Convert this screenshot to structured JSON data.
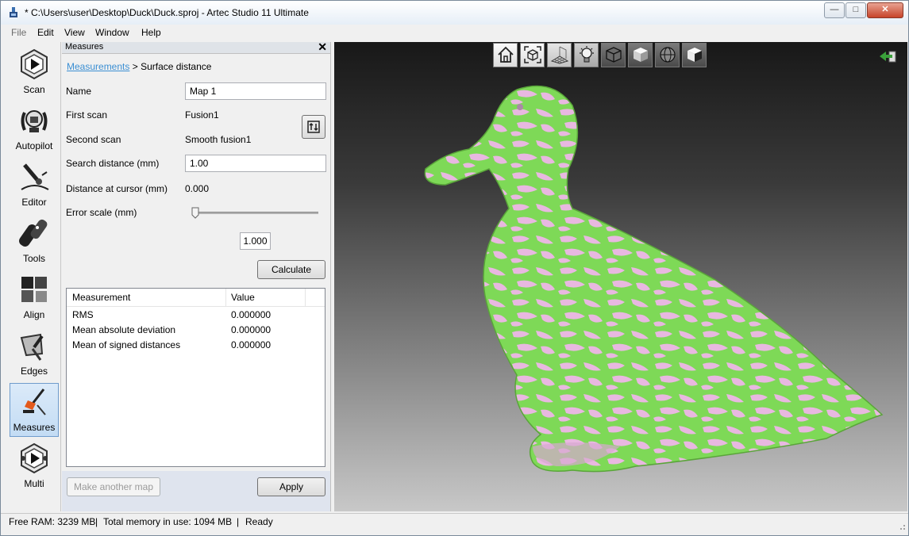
{
  "window": {
    "title": "* C:\\Users\\user\\Desktop\\Duck\\Duck.sproj - Artec Studio 11 Ultimate",
    "controls": {
      "minimize": "—",
      "maximize": "□",
      "close": "✕"
    }
  },
  "menu": [
    "File",
    "Edit",
    "View",
    "Window",
    "Help"
  ],
  "sidebar": {
    "items": [
      {
        "label": "Scan",
        "icon": "scan-icon"
      },
      {
        "label": "Autopilot",
        "icon": "autopilot-icon"
      },
      {
        "label": "Editor",
        "icon": "editor-icon"
      },
      {
        "label": "Tools",
        "icon": "tools-icon"
      },
      {
        "label": "Align",
        "icon": "align-icon"
      },
      {
        "label": "Edges",
        "icon": "edges-icon"
      },
      {
        "label": "Measures",
        "icon": "measures-icon",
        "active": true
      },
      {
        "label": "Multi",
        "icon": "multi-icon"
      }
    ]
  },
  "panel": {
    "title": "Measures",
    "close": "✕",
    "breadcrumb": {
      "link": "Measurements",
      "separator": " > ",
      "current": "Surface distance"
    },
    "fields": {
      "name_label": "Name",
      "name_value": "Map 1",
      "first_scan_label": "First scan",
      "first_scan_value": "Fusion1",
      "second_scan_label": "Second scan",
      "second_scan_value": "Smooth fusion1",
      "search_distance_label": "Search distance (mm)",
      "search_distance_value": "1.00",
      "distance_cursor_label": "Distance at cursor (mm)",
      "distance_cursor_value": "0.000",
      "error_scale_label": "Error scale (mm)",
      "error_scale_value": "1.000",
      "error_scale_slider_level": 0.02
    },
    "calculate_label": "Calculate",
    "table": {
      "headers": [
        "Measurement",
        "Value"
      ],
      "rows": [
        [
          "RMS",
          "0.000000"
        ],
        [
          "Mean absolute deviation",
          "0.000000"
        ],
        [
          "Mean of signed distances",
          "0.000000"
        ]
      ]
    },
    "make_another_label": "Make another map",
    "apply_label": "Apply"
  },
  "viewport": {
    "toolbar_icons": [
      "home-view-icon",
      "fit-view-icon",
      "grid-icon",
      "light-icon",
      "wireframe-cube-icon",
      "solid-cube-icon",
      "sphere-icon",
      "texture-cube-icon"
    ],
    "colors": {
      "green": "#7ed957",
      "pink": "#e8b8e0"
    }
  },
  "status": {
    "free_ram": "Free RAM: 3239 MB",
    "sep": "|",
    "total_memory": "Total memory in use: 1094 MB",
    "state": "Ready"
  }
}
